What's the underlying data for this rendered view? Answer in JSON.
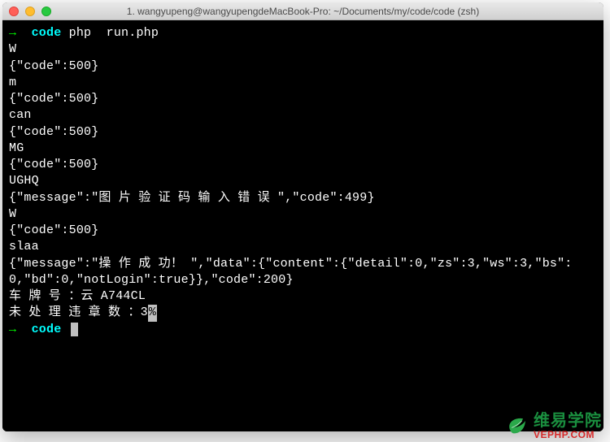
{
  "window": {
    "title": "1. wangyupeng@wangyupengdeMacBook-Pro: ~/Documents/my/code/code (zsh)"
  },
  "prompt": {
    "arrow": "→",
    "path": "code"
  },
  "command": "php  run.php",
  "output": {
    "l1": "W",
    "l2": "{\"code\":500}",
    "l3": "m",
    "l4": "{\"code\":500}",
    "l5": "can",
    "l6": "{\"code\":500}",
    "l7": "MG",
    "l8": "{\"code\":500}",
    "l9": "UGHQ",
    "l10": "{\"message\":\"图 片 验 证 码 输 入 错 误 \",\"code\":499}",
    "l11": "W",
    "l12": "{\"code\":500}",
    "l13": "slaa",
    "l14": "{\"message\":\"操 作 成 功！ \",\"data\":{\"content\":{\"detail\":0,\"zs\":3,\"ws\":3,\"bs\":0,\"bd\":0,\"notLogin\":true}},\"code\":200}",
    "l15": "车 牌 号 ：云 A744CL",
    "l16_a": "未 处 理 违 章 数 ：3",
    "l16_b": "%"
  },
  "watermark": {
    "cn": "维易学院",
    "en": "VEPHP.COM"
  }
}
